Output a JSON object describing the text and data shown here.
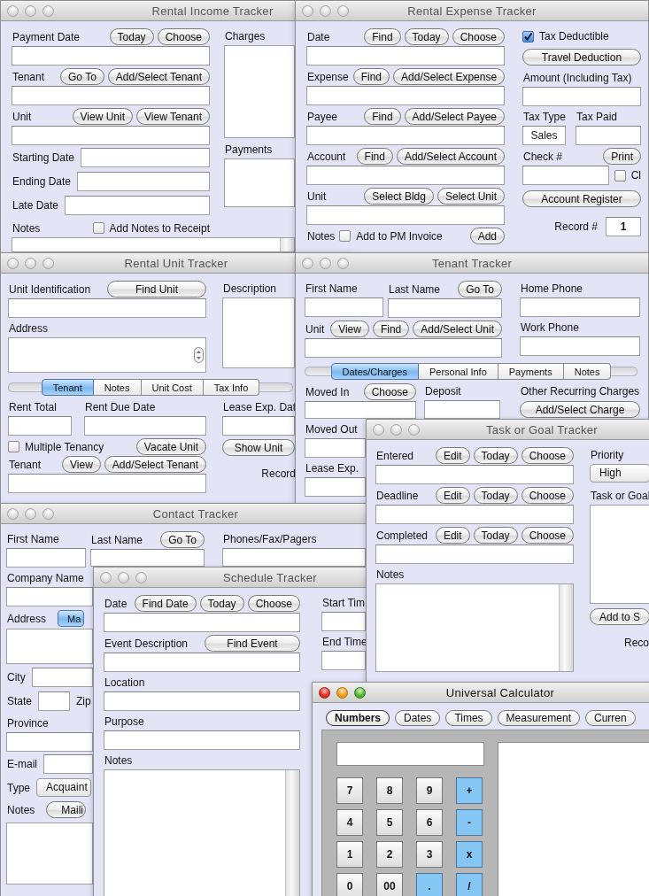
{
  "windows": [
    {
      "title": "Rental Income Tracker",
      "active": false,
      "kind": "form",
      "body": [
        {
          "kind": "columns",
          "parts": [
            [
              {
                "kind": "row",
                "items": [
                  {
                    "kind": "label",
                    "text": "Payment Date"
                  },
                  {
                    "kind": "button",
                    "text": "Today"
                  },
                  {
                    "kind": "button",
                    "text": "Choose"
                  }
                ]
              },
              {
                "kind": "field"
              },
              {
                "kind": "row",
                "items": [
                  {
                    "kind": "label",
                    "text": "Tenant"
                  },
                  {
                    "kind": "button",
                    "text": "Go To"
                  },
                  {
                    "kind": "button",
                    "text": "Add/Select Tenant"
                  }
                ]
              },
              {
                "kind": "field"
              },
              {
                "kind": "row",
                "items": [
                  {
                    "kind": "label",
                    "text": "Unit"
                  },
                  {
                    "kind": "button",
                    "text": "View Unit"
                  },
                  {
                    "kind": "button",
                    "text": "View Tenant"
                  }
                ]
              },
              {
                "kind": "field"
              },
              {
                "kind": "row",
                "items": [
                  {
                    "kind": "label",
                    "text": "Starting Date"
                  },
                  {
                    "kind": "field"
                  }
                ]
              },
              {
                "kind": "row",
                "items": [
                  {
                    "kind": "label",
                    "text": "Ending Date"
                  },
                  {
                    "kind": "field"
                  }
                ]
              },
              {
                "kind": "row",
                "items": [
                  {
                    "kind": "label",
                    "text": "Late Date"
                  },
                  {
                    "kind": "field"
                  }
                ]
              },
              {
                "kind": "row",
                "items": [
                  {
                    "kind": "label",
                    "text": "Notes"
                  },
                  {
                    "kind": "checkbox",
                    "text": "Add Notes to Receipt",
                    "checked": false
                  }
                ]
              }
            ],
            [
              {
                "kind": "label",
                "text": "Charges"
              },
              {
                "kind": "area"
              },
              {
                "kind": "label",
                "text": "Payments"
              },
              {
                "kind": "area"
              }
            ]
          ]
        },
        {
          "kind": "area_scroll"
        }
      ]
    },
    {
      "title": "Rental Expense Tracker",
      "active": false,
      "kind": "form",
      "body": [
        {
          "kind": "columns",
          "parts": [
            [
              {
                "kind": "row",
                "items": [
                  {
                    "kind": "label",
                    "text": "Date"
                  },
                  {
                    "kind": "button",
                    "text": "Find"
                  },
                  {
                    "kind": "button",
                    "text": "Today"
                  },
                  {
                    "kind": "button",
                    "text": "Choose"
                  }
                ]
              },
              {
                "kind": "field"
              },
              {
                "kind": "row",
                "items": [
                  {
                    "kind": "label",
                    "text": "Expense"
                  },
                  {
                    "kind": "button",
                    "text": "Find"
                  },
                  {
                    "kind": "button",
                    "text": "Add/Select Expense"
                  }
                ]
              },
              {
                "kind": "field"
              },
              {
                "kind": "row",
                "items": [
                  {
                    "kind": "label",
                    "text": "Payee"
                  },
                  {
                    "kind": "button",
                    "text": "Find"
                  },
                  {
                    "kind": "button",
                    "text": "Add/Select Payee"
                  }
                ]
              },
              {
                "kind": "field"
              },
              {
                "kind": "row",
                "items": [
                  {
                    "kind": "label",
                    "text": "Account"
                  },
                  {
                    "kind": "button",
                    "text": "Find"
                  },
                  {
                    "kind": "button",
                    "text": "Add/Select Account"
                  }
                ]
              },
              {
                "kind": "field"
              },
              {
                "kind": "row",
                "items": [
                  {
                    "kind": "label",
                    "text": "Unit"
                  },
                  {
                    "kind": "button",
                    "text": "Select Bldg"
                  },
                  {
                    "kind": "button",
                    "text": "Select Unit"
                  }
                ]
              },
              {
                "kind": "field"
              },
              {
                "kind": "row",
                "items": [
                  {
                    "kind": "label",
                    "text": "Notes"
                  },
                  {
                    "kind": "checkbox",
                    "text": "Add to PM Invoice",
                    "checked": false
                  },
                  {
                    "kind": "button",
                    "text": "Add"
                  }
                ]
              }
            ],
            [
              {
                "kind": "checkbox",
                "text": "Tax Deductible",
                "checked": true
              },
              {
                "kind": "wide_button",
                "text": "Travel Deduction"
              },
              {
                "kind": "label",
                "text": "Amount (Including Tax)"
              },
              {
                "kind": "field"
              },
              {
                "kind": "columns",
                "parts": [
                  [
                    {
                      "kind": "label",
                      "text": "Tax Type"
                    },
                    {
                      "kind": "field",
                      "value": "Sales"
                    }
                  ],
                  [
                    {
                      "kind": "label",
                      "text": "Tax Paid"
                    },
                    {
                      "kind": "field"
                    }
                  ]
                ]
              },
              {
                "kind": "row",
                "items": [
                  {
                    "kind": "label",
                    "text": "Check #"
                  },
                  {
                    "kind": "button",
                    "text": "Print"
                  }
                ]
              },
              {
                "kind": "row",
                "items": [
                  {
                    "kind": "field"
                  },
                  {
                    "kind": "checkbox",
                    "text": "Cl",
                    "checked": false
                  }
                ]
              },
              {
                "kind": "wide_button",
                "text": "Account Register"
              },
              {
                "kind": "record",
                "label": "Record #",
                "value": "1"
              }
            ]
          ]
        }
      ]
    },
    {
      "title": "Rental Unit Tracker",
      "active": false,
      "kind": "form",
      "body": [
        {
          "kind": "columns",
          "parts": [
            [
              {
                "kind": "row",
                "items": [
                  {
                    "kind": "label",
                    "text": "Unit Identification"
                  },
                  {
                    "kind": "wide_button",
                    "text": "Find Unit"
                  }
                ]
              },
              {
                "kind": "field"
              },
              {
                "kind": "label",
                "text": "Address"
              },
              {
                "kind": "area_stepper"
              }
            ],
            [
              {
                "kind": "label",
                "text": "Description"
              },
              {
                "kind": "area"
              }
            ]
          ]
        },
        {
          "kind": "tabs",
          "tabs": [
            {
              "label": "Tenant",
              "selected": true
            },
            {
              "label": "Notes",
              "selected": false
            },
            {
              "label": "Unit Cost",
              "selected": false
            },
            {
              "label": "Tax Info",
              "selected": false
            }
          ]
        },
        {
          "kind": "columns",
          "parts": [
            [
              {
                "kind": "columns",
                "parts": [
                  [
                    {
                      "kind": "label",
                      "text": "Rent Total"
                    },
                    {
                      "kind": "field"
                    }
                  ],
                  [
                    {
                      "kind": "label",
                      "text": "Rent Due Date"
                    },
                    {
                      "kind": "field"
                    }
                  ]
                ]
              },
              {
                "kind": "row",
                "items": [
                  {
                    "kind": "checkbox",
                    "text": "Multiple Tenancy",
                    "checked": false
                  },
                  {
                    "kind": "button",
                    "text": "Vacate Unit"
                  }
                ]
              },
              {
                "kind": "row",
                "items": [
                  {
                    "kind": "label",
                    "text": "Tenant"
                  },
                  {
                    "kind": "button",
                    "text": "View"
                  },
                  {
                    "kind": "button",
                    "text": "Add/Select Tenant"
                  }
                ]
              },
              {
                "kind": "field"
              }
            ],
            [
              {
                "kind": "label",
                "text": "Lease Exp. Dat"
              },
              {
                "kind": "field"
              },
              {
                "kind": "wide_button",
                "text": "Show Unit"
              },
              {
                "kind": "record",
                "label": "Record"
              }
            ]
          ]
        }
      ]
    },
    {
      "title": "Tenant Tracker",
      "active": false,
      "kind": "form",
      "body": [
        {
          "kind": "columns",
          "parts": [
            [
              {
                "kind": "columns",
                "parts": [
                  [
                    {
                      "kind": "label",
                      "text": "First Name"
                    },
                    {
                      "kind": "field"
                    }
                  ],
                  [
                    {
                      "kind": "row",
                      "items": [
                        {
                          "kind": "label",
                          "text": "Last Name"
                        },
                        {
                          "kind": "button",
                          "text": "Go To"
                        }
                      ]
                    },
                    {
                      "kind": "field"
                    }
                  ]
                ]
              },
              {
                "kind": "row",
                "items": [
                  {
                    "kind": "label",
                    "text": "Unit"
                  },
                  {
                    "kind": "button",
                    "text": "View"
                  },
                  {
                    "kind": "button",
                    "text": "Find"
                  },
                  {
                    "kind": "button",
                    "text": "Add/Select Unit"
                  }
                ]
              },
              {
                "kind": "field"
              }
            ],
            [
              {
                "kind": "label",
                "text": "Home Phone"
              },
              {
                "kind": "field"
              },
              {
                "kind": "label",
                "text": "Work Phone"
              },
              {
                "kind": "field"
              }
            ]
          ]
        },
        {
          "kind": "tabs",
          "tabs": [
            {
              "label": "Dates/Charges",
              "selected": true
            },
            {
              "label": "Personal Info",
              "selected": false
            },
            {
              "label": "Payments",
              "selected": false
            },
            {
              "label": "Notes",
              "selected": false
            }
          ]
        },
        {
          "kind": "columns",
          "parts": [
            [
              {
                "kind": "columns",
                "parts": [
                  [
                    {
                      "kind": "row",
                      "items": [
                        {
                          "kind": "label",
                          "text": "Moved In"
                        },
                        {
                          "kind": "button",
                          "text": "Choose"
                        }
                      ]
                    },
                    {
                      "kind": "field"
                    }
                  ],
                  [
                    {
                      "kind": "label",
                      "text": "Deposit"
                    },
                    {
                      "kind": "field"
                    }
                  ]
                ]
              },
              {
                "kind": "label",
                "text": "Moved Out"
              },
              {
                "kind": "field"
              },
              {
                "kind": "label",
                "text": "Lease Exp."
              },
              {
                "kind": "field"
              }
            ],
            [
              {
                "kind": "label",
                "text": "Other Recurring Charges"
              },
              {
                "kind": "wide_button",
                "text": "Add/Select Charge"
              }
            ]
          ]
        }
      ]
    },
    {
      "title": "Contact Tracker",
      "active": false,
      "kind": "form",
      "body": [
        {
          "kind": "columns",
          "parts": [
            [
              {
                "kind": "columns",
                "parts": [
                  [
                    {
                      "kind": "label",
                      "text": "First Name"
                    },
                    {
                      "kind": "field"
                    }
                  ],
                  [
                    {
                      "kind": "row",
                      "items": [
                        {
                          "kind": "label",
                          "text": "Last Name"
                        },
                        {
                          "kind": "button",
                          "text": "Go To"
                        }
                      ]
                    },
                    {
                      "kind": "field"
                    }
                  ]
                ]
              },
              {
                "kind": "label",
                "text": "Company Name"
              },
              {
                "kind": "field"
              },
              {
                "kind": "row",
                "items": [
                  {
                    "kind": "label",
                    "text": "Address"
                  },
                  {
                    "kind": "tabs",
                    "tabs": [
                      {
                        "label": "Ma",
                        "selected": true
                      }
                    ]
                  }
                ]
              },
              {
                "kind": "area"
              },
              {
                "kind": "row",
                "items": [
                  {
                    "kind": "label",
                    "text": "City"
                  },
                  {
                    "kind": "field"
                  }
                ]
              },
              {
                "kind": "row",
                "items": [
                  {
                    "kind": "label",
                    "text": "State"
                  },
                  {
                    "kind": "field"
                  },
                  {
                    "kind": "label",
                    "text": "Zip"
                  }
                ]
              },
              {
                "kind": "label",
                "text": "Province"
              },
              {
                "kind": "field"
              },
              {
                "kind": "row",
                "items": [
                  {
                    "kind": "label",
                    "text": "E-mail"
                  },
                  {
                    "kind": "field"
                  }
                ]
              },
              {
                "kind": "row",
                "items": [
                  {
                    "kind": "label",
                    "text": "Type"
                  },
                  {
                    "kind": "popup",
                    "value": "Acquaint"
                  }
                ]
              },
              {
                "kind": "row",
                "items": [
                  {
                    "kind": "label",
                    "text": "Notes"
                  },
                  {
                    "kind": "menu_button",
                    "text": "Maili"
                  }
                ]
              },
              {
                "kind": "area"
              }
            ],
            [
              {
                "kind": "label",
                "text": "Phones/Fax/Pagers"
              },
              {
                "kind": "field"
              }
            ]
          ]
        }
      ]
    },
    {
      "title": "Schedule Tracker",
      "active": false,
      "kind": "form",
      "body": [
        {
          "kind": "columns",
          "parts": [
            [
              {
                "kind": "row",
                "items": [
                  {
                    "kind": "label",
                    "text": "Date"
                  },
                  {
                    "kind": "button",
                    "text": "Find Date"
                  },
                  {
                    "kind": "button",
                    "text": "Today"
                  },
                  {
                    "kind": "button",
                    "text": "Choose"
                  }
                ]
              },
              {
                "kind": "field"
              },
              {
                "kind": "row",
                "items": [
                  {
                    "kind": "label",
                    "text": "Event Description"
                  },
                  {
                    "kind": "wide_button",
                    "text": "Find Event"
                  }
                ]
              },
              {
                "kind": "field"
              },
              {
                "kind": "label",
                "text": "Location"
              },
              {
                "kind": "field"
              },
              {
                "kind": "label",
                "text": "Purpose"
              },
              {
                "kind": "field"
              },
              {
                "kind": "label",
                "text": "Notes"
              },
              {
                "kind": "area_scroll"
              }
            ],
            [
              {
                "kind": "label",
                "text": "Start Tim"
              },
              {
                "kind": "field"
              },
              {
                "kind": "label",
                "text": "End Time"
              },
              {
                "kind": "field"
              }
            ]
          ]
        }
      ]
    },
    {
      "title": "Task or Goal Tracker",
      "active": false,
      "kind": "form",
      "body": [
        {
          "kind": "columns",
          "parts": [
            [
              {
                "kind": "row",
                "items": [
                  {
                    "kind": "label",
                    "text": "Entered"
                  },
                  {
                    "kind": "button",
                    "text": "Edit"
                  },
                  {
                    "kind": "button",
                    "text": "Today"
                  },
                  {
                    "kind": "button",
                    "text": "Choose"
                  }
                ]
              },
              {
                "kind": "field"
              },
              {
                "kind": "row",
                "items": [
                  {
                    "kind": "label",
                    "text": "Deadline"
                  },
                  {
                    "kind": "button",
                    "text": "Edit"
                  },
                  {
                    "kind": "button",
                    "text": "Today"
                  },
                  {
                    "kind": "button",
                    "text": "Choose"
                  }
                ]
              },
              {
                "kind": "field"
              },
              {
                "kind": "row",
                "items": [
                  {
                    "kind": "label",
                    "text": "Completed"
                  },
                  {
                    "kind": "button",
                    "text": "Edit"
                  },
                  {
                    "kind": "button",
                    "text": "Today"
                  },
                  {
                    "kind": "button",
                    "text": "Choose"
                  }
                ]
              },
              {
                "kind": "field"
              },
              {
                "kind": "label",
                "text": "Notes"
              },
              {
                "kind": "area_scroll"
              }
            ],
            [
              {
                "kind": "label",
                "text": "Priority"
              },
              {
                "kind": "popup",
                "value": "High"
              },
              {
                "kind": "label",
                "text": "Task or Goal"
              },
              {
                "kind": "area"
              },
              {
                "kind": "wide_button",
                "text": "Add to S"
              },
              {
                "kind": "record",
                "label": "Reco"
              }
            ]
          ]
        }
      ]
    },
    {
      "title": "Universal Calculator",
      "active": true,
      "kind": "calculator",
      "modes": [
        {
          "label": "Numbers",
          "selected": true
        },
        {
          "label": "Dates",
          "selected": false
        },
        {
          "label": "Times",
          "selected": false
        },
        {
          "label": "Measurement",
          "selected": false
        },
        {
          "label": "Curren",
          "selected": false
        }
      ],
      "keys": [
        {
          "label": "7",
          "kind": "digit"
        },
        {
          "label": "8",
          "kind": "digit"
        },
        {
          "label": "9",
          "kind": "digit"
        },
        {
          "label": "+",
          "kind": "op"
        },
        {
          "label": "4",
          "kind": "digit"
        },
        {
          "label": "5",
          "kind": "digit"
        },
        {
          "label": "6",
          "kind": "digit"
        },
        {
          "label": "-",
          "kind": "op"
        },
        {
          "label": "1",
          "kind": "digit"
        },
        {
          "label": "2",
          "kind": "digit"
        },
        {
          "label": "3",
          "kind": "digit"
        },
        {
          "label": "x",
          "kind": "op"
        },
        {
          "label": "0",
          "kind": "digit"
        },
        {
          "label": "00",
          "kind": "digit"
        },
        {
          "label": ".",
          "kind": "op"
        },
        {
          "label": "/",
          "kind": "op"
        }
      ]
    }
  ]
}
